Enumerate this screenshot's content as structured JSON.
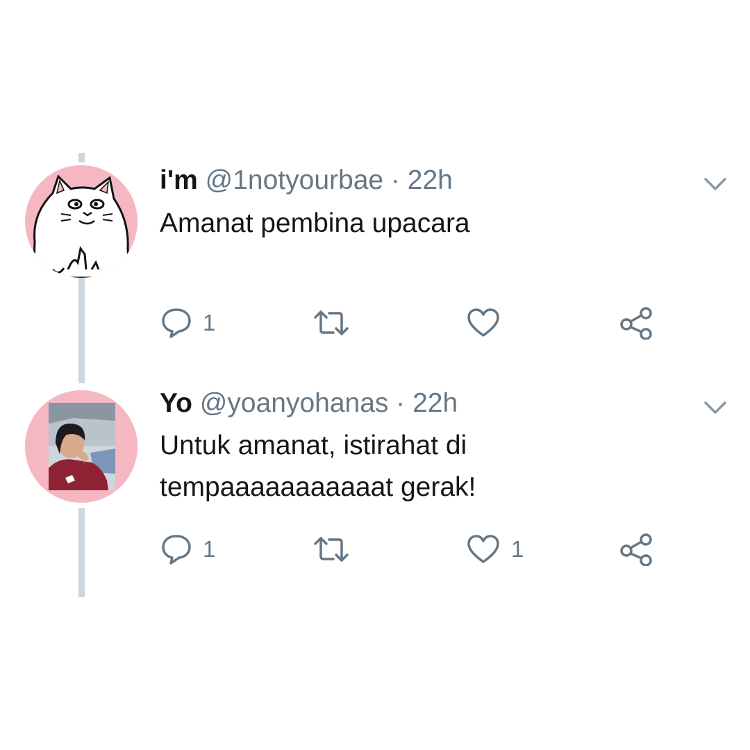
{
  "tweets": [
    {
      "display_name": "i'm",
      "handle": "@1notyourbae",
      "separator": "·",
      "time": "22h",
      "text_lines": [
        "Amanat pembina upacara"
      ],
      "reply_count": "1",
      "retweet_count": "",
      "like_count": "",
      "avatar_icon": "white-cat-middle-finger-avatar",
      "avatar_bg": "#f5b8c3"
    },
    {
      "display_name": "Yo",
      "handle": "@yoanyohanas",
      "separator": "·",
      "time": "22h",
      "text_lines": [
        "Untuk amanat, istirahat di",
        "tempaaaaaaaaaaat gerak!"
      ],
      "reply_count": "1",
      "retweet_count": "",
      "like_count": "1",
      "avatar_icon": "person-photo-avatar",
      "avatar_bg": "#f5b8c3"
    }
  ],
  "colors": {
    "primary_text": "#14171a",
    "secondary_text": "#657786",
    "thread_line": "#ccd6dd",
    "avatar_ring": "#f5b8c3"
  },
  "icons": [
    "reply-icon",
    "retweet-icon",
    "like-icon",
    "share-icon",
    "chevron-down-icon"
  ]
}
